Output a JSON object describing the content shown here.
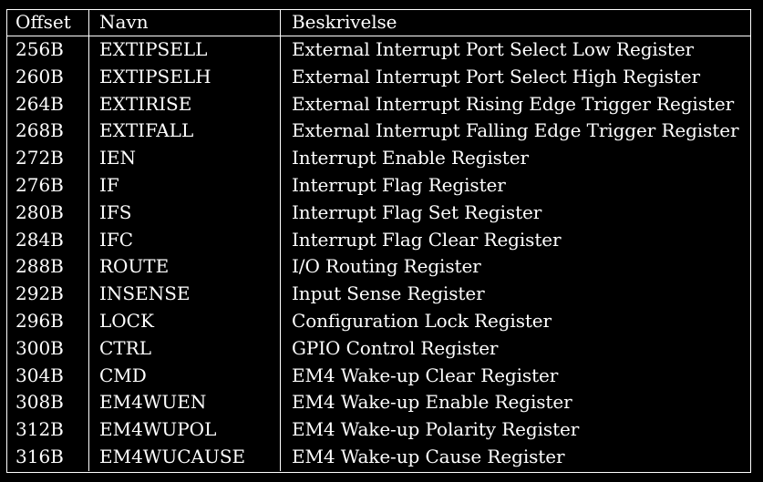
{
  "table": {
    "headers": {
      "offset": "Offset",
      "name": "Navn",
      "description": "Beskrivelse"
    },
    "rows": [
      {
        "offset": "256B",
        "name": "EXTIPSELL",
        "description": "External Interrupt Port Select Low Register"
      },
      {
        "offset": "260B",
        "name": "EXTIPSELH",
        "description": "External Interrupt Port Select High Register"
      },
      {
        "offset": "264B",
        "name": "EXTIRISE",
        "description": "External Interrupt Rising Edge Trigger Register"
      },
      {
        "offset": "268B",
        "name": "EXTIFALL",
        "description": "External Interrupt Falling Edge Trigger Register"
      },
      {
        "offset": "272B",
        "name": "IEN",
        "description": "Interrupt Enable Register"
      },
      {
        "offset": "276B",
        "name": "IF",
        "description": "Interrupt Flag Register"
      },
      {
        "offset": "280B",
        "name": "IFS",
        "description": "Interrupt Flag Set Register"
      },
      {
        "offset": "284B",
        "name": "IFC",
        "description": "Interrupt Flag Clear Register"
      },
      {
        "offset": "288B",
        "name": "ROUTE",
        "description": "I/O Routing Register"
      },
      {
        "offset": "292B",
        "name": "INSENSE",
        "description": "Input Sense Register"
      },
      {
        "offset": "296B",
        "name": "LOCK",
        "description": "Configuration Lock Register"
      },
      {
        "offset": "300B",
        "name": "CTRL",
        "description": "GPIO Control Register"
      },
      {
        "offset": "304B",
        "name": "CMD",
        "description": "EM4 Wake-up Clear Register"
      },
      {
        "offset": "308B",
        "name": "EM4WUEN",
        "description": "EM4 Wake-up Enable Register"
      },
      {
        "offset": "312B",
        "name": "EM4WUPOL",
        "description": "EM4 Wake-up Polarity Register"
      },
      {
        "offset": "316B",
        "name": "EM4WUCAUSE",
        "description": "EM4 Wake-up Cause Register"
      }
    ]
  },
  "colors": {
    "background": "#000000",
    "text": "#ffffff",
    "rule": "#ffffff"
  }
}
